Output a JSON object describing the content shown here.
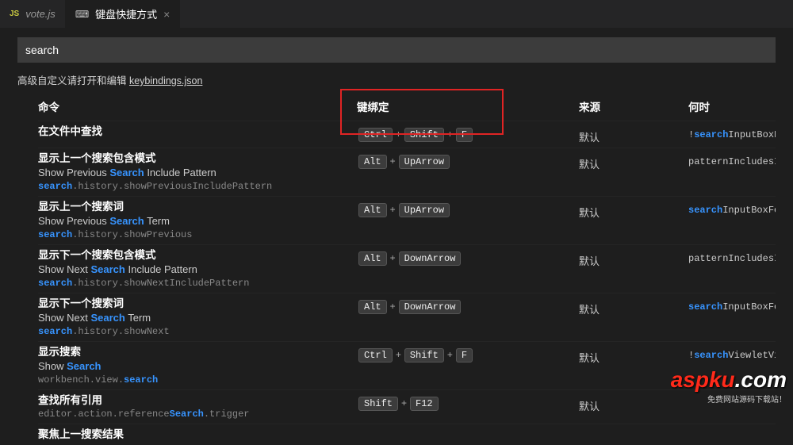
{
  "tabs": {
    "inactive_badge": "JS",
    "inactive_label": "vote.js",
    "active_label": "键盘快捷方式"
  },
  "search_value": "search",
  "adv": {
    "prefix": "高级自定义请打开和编辑 ",
    "link": "keybindings.json"
  },
  "cols": {
    "cmd": "命令",
    "kb": "键绑定",
    "src": "来源",
    "when": "何时"
  },
  "rows": [
    {
      "title_cn": "在文件中查找",
      "sub_pre": "",
      "sub_match": "",
      "sub_post": "",
      "id_pre": "",
      "id_match": "",
      "id_post": "",
      "keys": [
        "Ctrl",
        "Shift",
        "F"
      ],
      "src": "默认",
      "when_pre": "!",
      "when_match": "search",
      "when_post": "InputBoxFocus"
    },
    {
      "title_cn": "显示上一个搜索包含模式",
      "sub_pre": "Show Previous ",
      "sub_match": "Search",
      "sub_post": " Include Pattern",
      "id_pre": "",
      "id_match": "search",
      "id_post": ".history.showPreviousIncludePattern",
      "keys": [
        "Alt",
        "UpArrow"
      ],
      "src": "默认",
      "when_pre": "patternIncludesInputBo",
      "when_match": "",
      "when_post": ""
    },
    {
      "title_cn": "显示上一个搜索词",
      "sub_pre": "Show Previous ",
      "sub_match": "Search",
      "sub_post": " Term",
      "id_pre": "",
      "id_match": "search",
      "id_post": ".history.showPrevious",
      "keys": [
        "Alt",
        "UpArrow"
      ],
      "src": "默认",
      "when_pre": "",
      "when_match": "search",
      "when_post": "InputBoxFocus &&"
    },
    {
      "title_cn": "显示下一个搜索包含模式",
      "sub_pre": "Show Next ",
      "sub_match": "Search",
      "sub_post": " Include Pattern",
      "id_pre": "",
      "id_match": "search",
      "id_post": ".history.showNextIncludePattern",
      "keys": [
        "Alt",
        "DownArrow"
      ],
      "src": "默认",
      "when_pre": "patternIncludesInputBo",
      "when_match": "",
      "when_post": ""
    },
    {
      "title_cn": "显示下一个搜索词",
      "sub_pre": "Show Next ",
      "sub_match": "Search",
      "sub_post": " Term",
      "id_pre": "",
      "id_match": "search",
      "id_post": ".history.showNext",
      "keys": [
        "Alt",
        "DownArrow"
      ],
      "src": "默认",
      "when_pre": "",
      "when_match": "search",
      "when_post": "InputBoxFocus &&"
    },
    {
      "title_cn": "显示搜索",
      "sub_pre": "Show ",
      "sub_match": "Search",
      "sub_post": "",
      "id_pre": "workbench.view.",
      "id_match": "search",
      "id_post": "",
      "keys": [
        "Ctrl",
        "Shift",
        "F"
      ],
      "src": "默认",
      "when_pre": "!",
      "when_match": "search",
      "when_post": "ViewletVisible"
    },
    {
      "title_cn": "查找所有引用",
      "sub_pre": "",
      "sub_match": "",
      "sub_post": "",
      "id_pre": "editor.action.reference",
      "id_match": "Search",
      "id_post": ".trigger",
      "keys": [
        "Shift",
        "F12"
      ],
      "src": "默认",
      "when_pre": "",
      "when_match": "",
      "when_post": ""
    },
    {
      "title_cn": "聚焦上一搜索结果",
      "sub_pre": "",
      "sub_match": "",
      "sub_post": "",
      "id_pre": "",
      "id_match": "",
      "id_post": "",
      "keys": [],
      "src": "",
      "when_pre": "",
      "when_match": "",
      "when_post": ""
    }
  ],
  "watermark": {
    "main": "aspku",
    "suffix": ".com",
    "sub": "免费网站源码下载站！"
  }
}
